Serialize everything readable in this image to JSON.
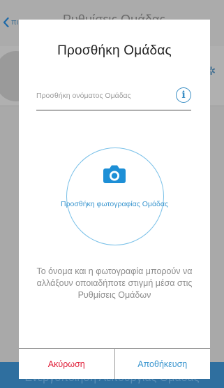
{
  "background": {
    "back_label": "πι",
    "title": "Ρυθμίσεις Ομάδας",
    "bottom_bar_label": "Ενεργοποίηση Λειτουργίας Ομάδας"
  },
  "dialog": {
    "title": "Προσθήκη Ομάδας",
    "name_input": {
      "value": "",
      "placeholder": "Προσθήκη ονόματος Ομάδας"
    },
    "info_icon": "i",
    "photo_label": "Προσθήκη φωτογραφίας Ομάδας",
    "hint": "Το όνομα και η φωτογραφία μπορούν να αλλάξουν οποιαδήποτε στιγμή μέσα στις Ρυθμίσεις Ομάδων",
    "cancel_label": "Ακύρωση",
    "save_label": "Αποθήκευση"
  },
  "colors": {
    "accent": "#3a96cf",
    "cancel": "#e0203a",
    "overlay": "#a9a9a9"
  },
  "icons": [
    "chevron-left-icon",
    "gear-icon",
    "info-icon",
    "camera-icon"
  ]
}
